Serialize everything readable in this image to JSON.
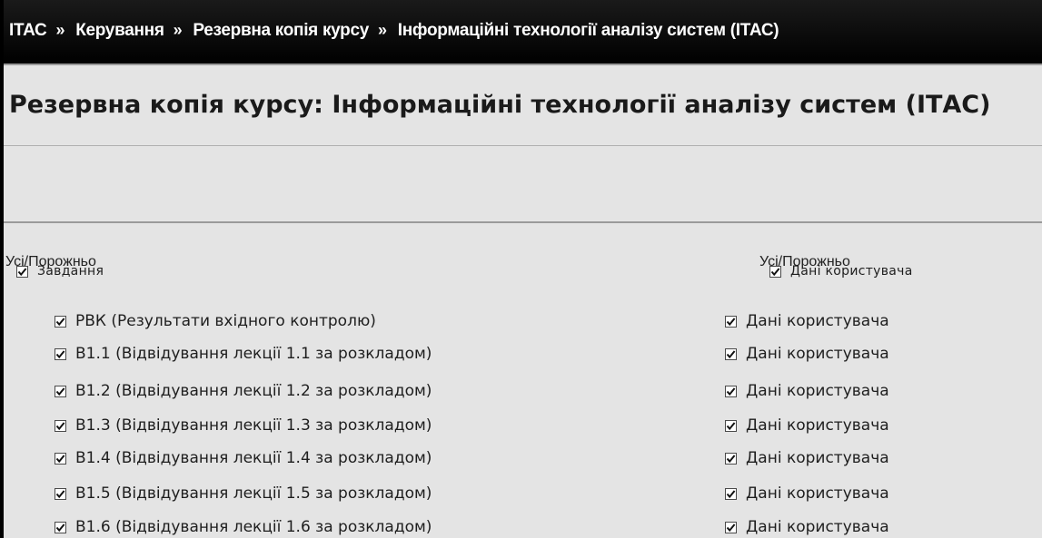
{
  "breadcrumb": {
    "items": [
      "ІТАС",
      "Керування",
      "Резервна копія курсу",
      "Інформаційні технології аналізу систем (ІТАС)"
    ],
    "separator": "»"
  },
  "page": {
    "title": "Резервна копія курсу: Інформаційні технології аналізу систем (ІТАС)"
  },
  "select_all": {
    "left": "Усі/Порожньо",
    "right": "Усі/Порожньо"
  },
  "sections": {
    "tasks_label": "Завдання",
    "user_data_label": "Дані користувача"
  },
  "rows": [
    {
      "left": "РВК (Результати вхідного контролю)",
      "right": "Дані користувача",
      "left_checked": true,
      "right_checked": true
    },
    {
      "left": "В1.1 (Відвідування лекції 1.1 за розкладом)",
      "right": "Дані користувача",
      "left_checked": true,
      "right_checked": true
    },
    {
      "left": "В1.2 (Відвідування лекції 1.2 за розкладом)",
      "right": "Дані користувача",
      "left_checked": true,
      "right_checked": true
    },
    {
      "left": "В1.3 (Відвідування лекції 1.3 за розкладом)",
      "right": "Дані користувача",
      "left_checked": true,
      "right_checked": true
    },
    {
      "left": "В1.4 (Відвідування лекції 1.4 за розкладом)",
      "right": "Дані користувача",
      "left_checked": true,
      "right_checked": true
    },
    {
      "left": "В1.5 (Відвідування лекції 1.5 за розкладом)",
      "right": "Дані користувача",
      "left_checked": true,
      "right_checked": true
    },
    {
      "left": "В1.6 (Відвідування лекції 1.6 за розкладом)",
      "right": "Дані користувача",
      "left_checked": true,
      "right_checked": true
    }
  ],
  "colors": {
    "navbar": "#000000",
    "background": "#e4e4e4",
    "text": "#1e1e1e"
  }
}
